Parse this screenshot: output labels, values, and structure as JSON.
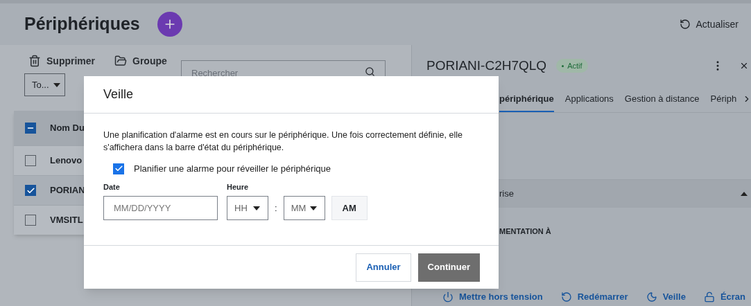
{
  "header": {
    "title": "Périphériques",
    "refresh_label": "Actualiser"
  },
  "toolbar": {
    "actions": [
      "Supprimer",
      "Groupe"
    ],
    "filter": "To...",
    "search": {
      "placeholder": "Rechercher"
    }
  },
  "table": {
    "select_all": {
      "indeterminate": true
    },
    "columns": [
      "Nom Du"
    ],
    "rows": [
      {
        "cells": [
          "Lenovo"
        ],
        "checked": false
      },
      {
        "cells": [
          "PORIAN"
        ],
        "checked": true
      },
      {
        "cells": [
          "VMSITL"
        ],
        "checked": false
      }
    ]
  },
  "detail": {
    "title": "PORIANI-C2H7QLQ",
    "status": "Actif",
    "tabs": [
      {
        "label": "périphérique",
        "selected": true
      },
      {
        "label": "Applications",
        "selected": false
      },
      {
        "label": "Gestion à distance",
        "selected": false
      },
      {
        "label": "Périph",
        "selected": false
      }
    ],
    "section": {
      "label": "rise",
      "expanded": true
    },
    "subheading": "MENTATION À",
    "actions": [
      "Mettre hors tension",
      "Redémarrer",
      "Veille",
      "Écran"
    ]
  },
  "dialog": {
    "title": "Veille",
    "message": "Une planification d'alarme est en cours sur le périphérique. Une fois correctement définie, elle s'affichera dans la barre d'état du périphérique.",
    "checkbox": {
      "label": "Planifier une alarme pour réveiller le périphérique",
      "checked": true
    },
    "date": {
      "label": "Date",
      "placeholder": "MM/DD/YYYY"
    },
    "time": {
      "label": "Heure",
      "hour": "HH",
      "separator": ":",
      "minute": "MM",
      "period": "AM"
    },
    "buttons": [
      {
        "label": "Annuler",
        "kind": "secondary"
      },
      {
        "label": "Continuer",
        "kind": "primary"
      }
    ]
  }
}
